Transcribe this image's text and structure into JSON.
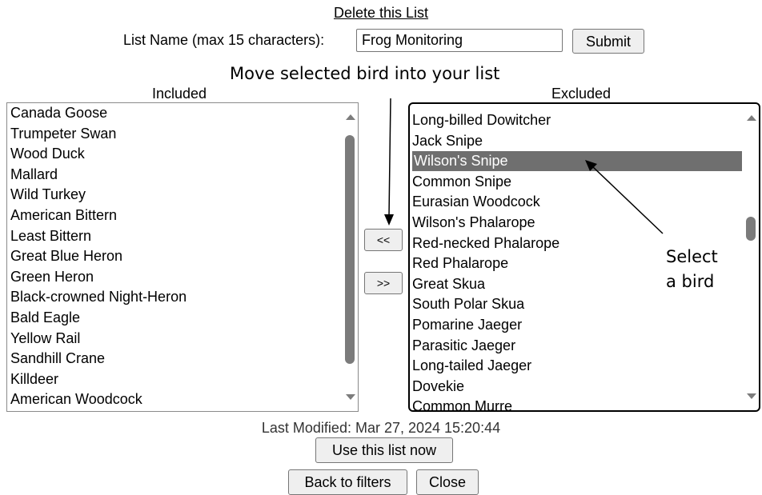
{
  "header": {
    "delete_link": "Delete this List",
    "list_name_label": "List Name (max 15 characters):",
    "list_name_value": "Frog Monitoring",
    "submit_label": "Submit"
  },
  "annotations": {
    "move_note": "Move selected bird into your list",
    "select_note_line1": "Select",
    "select_note_line2": "a bird"
  },
  "included": {
    "heading": "Included",
    "items": [
      "Canada Goose",
      "Trumpeter Swan",
      "Wood Duck",
      "Mallard",
      "Wild Turkey",
      "American Bittern",
      "Least Bittern",
      "Great Blue Heron",
      "Green Heron",
      "Black-crowned Night-Heron",
      "Bald Eagle",
      "Yellow Rail",
      "Sandhill Crane",
      "Killdeer",
      "American Woodcock"
    ]
  },
  "excluded": {
    "heading": "Excluded",
    "selected": "Wilson's Snipe",
    "items": [
      "Long-billed Dowitcher",
      "Jack Snipe",
      "Wilson's Snipe",
      "Common Snipe",
      "Eurasian Woodcock",
      "Wilson's Phalarope",
      "Red-necked Phalarope",
      "Red Phalarope",
      "Great Skua",
      "South Polar Skua",
      "Pomarine Jaeger",
      "Parasitic Jaeger",
      "Long-tailed Jaeger",
      "Dovekie",
      "Common Murre"
    ]
  },
  "move_buttons": {
    "move_in_label": "<<",
    "move_out_label": ">>"
  },
  "footer": {
    "last_modified": "Last Modified: Mar 27, 2024 15:20:44",
    "use_list_label": "Use this list now",
    "back_label": "Back to filters",
    "close_label": "Close"
  },
  "colors": {
    "selected_row": "#6f6f6f",
    "button_bg": "#efefef",
    "scrollbar": "#7b7b7b"
  }
}
